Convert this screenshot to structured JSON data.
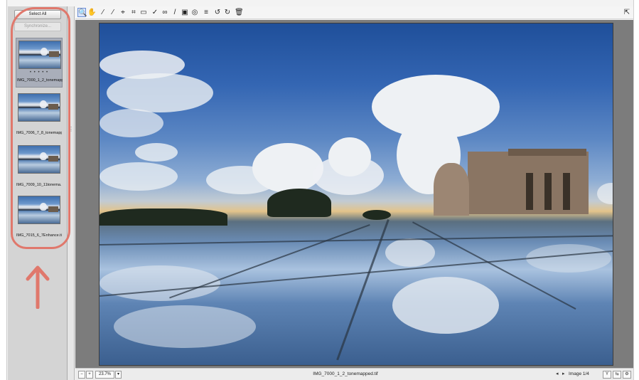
{
  "filmstrip": {
    "select_all_label": "Select All",
    "synchronize_label": "Synchronize...",
    "thumbnails": [
      {
        "name": "IMG_7000_1_2_tonemapp...",
        "stars": "• • • • •",
        "selected": true
      },
      {
        "name": "IMG_7006_7_8_tonemapp...",
        "stars": "",
        "selected": false
      },
      {
        "name": "IMG_7009_10_11tonema...",
        "stars": "",
        "selected": false
      },
      {
        "name": "IMG_7015_6_7Enhance.tif",
        "stars": "",
        "selected": false
      }
    ]
  },
  "toolbar": {
    "tools": [
      {
        "icon": "zoom-icon",
        "glyph": "🔍"
      },
      {
        "icon": "hand-icon",
        "glyph": "✋"
      },
      {
        "icon": "white-balance-icon",
        "glyph": "⁄"
      },
      {
        "icon": "color-sampler-icon",
        "glyph": "⁄"
      },
      {
        "icon": "targeted-adjustment-icon",
        "glyph": "⌖"
      },
      {
        "icon": "crop-icon",
        "glyph": "⌗"
      },
      {
        "icon": "straighten-icon",
        "glyph": "▭"
      },
      {
        "icon": "spot-removal-icon",
        "glyph": "✓"
      },
      {
        "icon": "red-eye-icon",
        "glyph": "∞"
      },
      {
        "icon": "adjustment-brush-icon",
        "glyph": "/"
      },
      {
        "icon": "graduated-filter-icon",
        "glyph": "▣"
      },
      {
        "icon": "radial-filter-icon",
        "glyph": "◎"
      },
      {
        "icon": "preferences-icon",
        "glyph": "≡"
      },
      {
        "icon": "rotate-left-icon",
        "glyph": "↺"
      },
      {
        "icon": "rotate-right-icon",
        "glyph": "↻"
      },
      {
        "icon": "trash-icon",
        "glyph": "🗑"
      }
    ],
    "fullscreen_icon": "fullscreen-icon",
    "fullscreen_glyph": "⇱"
  },
  "statusbar": {
    "zoom_value": "23.7%",
    "filename": "IMG_7000_1_2_tonemapped.tif",
    "image_count": "Image 1/4",
    "prev_glyph": "◂",
    "next_glyph": "▸"
  },
  "colors": {
    "annotation": "#e0786c",
    "selection": "#a9aeba",
    "preview_background": "#7c7c7c"
  }
}
